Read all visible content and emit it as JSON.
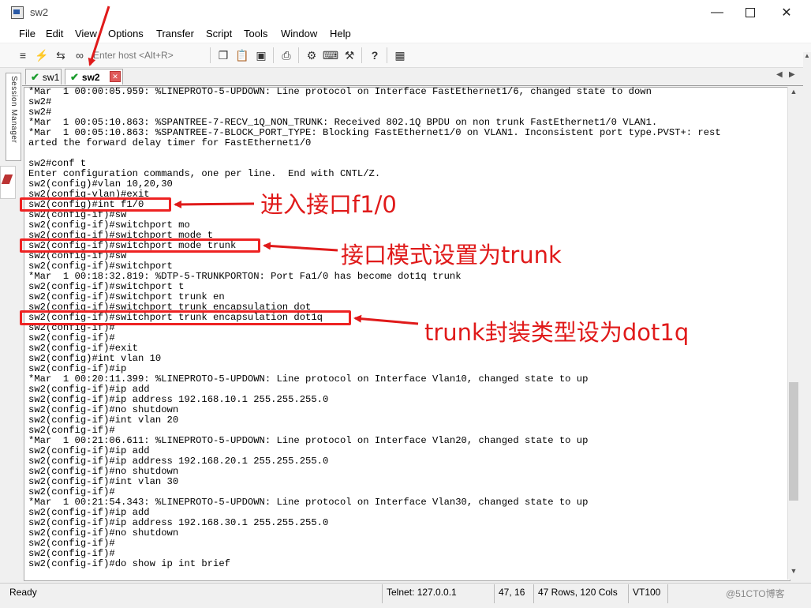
{
  "window": {
    "title": "sw2",
    "min_icon": "minimize-icon",
    "max_icon": "maximize-icon",
    "close_icon": "close-icon"
  },
  "menu": [
    "File",
    "Edit",
    "View",
    "Options",
    "Transfer",
    "Script",
    "Tools",
    "Window",
    "Help"
  ],
  "toolbar": {
    "host_placeholder": "Enter host <Alt+R>",
    "icons": [
      "connect-icon",
      "lightning-icon",
      "reconnect-icon",
      "disconnect-icon",
      "copy-icon",
      "paste-icon",
      "find-icon",
      "print-icon",
      "settings-icon",
      "keymap-icon",
      "help-icon",
      "sftp-icon"
    ]
  },
  "session_manager": {
    "label": "Session Manager"
  },
  "tabs": [
    {
      "label": "sw1",
      "active": false
    },
    {
      "label": "sw2",
      "active": true
    }
  ],
  "terminal": {
    "lines": [
      "*Mar  1 00:00:05.959: %LINEPROTO-5-UPDOWN: Line protocol on Interface FastEthernet1/6, changed state to down",
      "sw2#",
      "sw2#",
      "*Mar  1 00:05:10.863: %SPANTREE-7-RECV_1Q_NON_TRUNK: Received 802.1Q BPDU on non trunk FastEthernet1/0 VLAN1.",
      "*Mar  1 00:05:10.863: %SPANTREE-7-BLOCK_PORT_TYPE: Blocking FastEthernet1/0 on VLAN1. Inconsistent port type.PVST+: rest",
      "arted the forward delay timer for FastEthernet1/0",
      "",
      "sw2#conf t",
      "Enter configuration commands, one per line.  End with CNTL/Z.",
      "sw2(config)#vlan 10,20,30",
      "sw2(config-vlan)#exit",
      "sw2(config)#int f1/0",
      "sw2(config-if)#sw",
      "sw2(config-if)#switchport mo",
      "sw2(config-if)#switchport mode t",
      "sw2(config-if)#switchport mode trunk",
      "sw2(config-if)#sw",
      "sw2(config-if)#switchport",
      "*Mar  1 00:18:32.819: %DTP-5-TRUNKPORTON: Port Fa1/0 has become dot1q trunk",
      "sw2(config-if)#switchport t",
      "sw2(config-if)#switchport trunk en",
      "sw2(config-if)#switchport trunk encapsulation dot",
      "sw2(config-if)#switchport trunk encapsulation dot1q",
      "sw2(config-if)#",
      "sw2(config-if)#",
      "sw2(config-if)#exit",
      "sw2(config)#int vlan 10",
      "sw2(config-if)#ip",
      "*Mar  1 00:20:11.399: %LINEPROTO-5-UPDOWN: Line protocol on Interface Vlan10, changed state to up",
      "sw2(config-if)#ip add",
      "sw2(config-if)#ip address 192.168.10.1 255.255.255.0",
      "sw2(config-if)#no shutdown",
      "sw2(config-if)#int vlan 20",
      "sw2(config-if)#",
      "*Mar  1 00:21:06.611: %LINEPROTO-5-UPDOWN: Line protocol on Interface Vlan20, changed state to up",
      "sw2(config-if)#ip add",
      "sw2(config-if)#ip address 192.168.20.1 255.255.255.0",
      "sw2(config-if)#no shutdown",
      "sw2(config-if)#int vlan 30",
      "sw2(config-if)#",
      "*Mar  1 00:21:54.343: %LINEPROTO-5-UPDOWN: Line protocol on Interface Vlan30, changed state to up",
      "sw2(config-if)#ip add",
      "sw2(config-if)#ip address 192.168.30.1 255.255.255.0",
      "sw2(config-if)#no shutdown",
      "sw2(config-if)#",
      "sw2(config-if)#",
      "sw2(config-if)#do show ip int brief"
    ]
  },
  "annotations": [
    {
      "text": "进入接口f1/0"
    },
    {
      "text": "接口模式设置为trunk"
    },
    {
      "text": "trunk封装类型设为dot1q"
    }
  ],
  "status": {
    "ready": "Ready",
    "connection": "Telnet: 127.0.0.1",
    "cursor": "47, 16",
    "size": "47 Rows, 120 Cols",
    "terminal_type": "VT100",
    "watermark": "@51CTO博客"
  },
  "colors": {
    "annotation": "#e01a1a",
    "tab_check": "#1a9c2c"
  }
}
